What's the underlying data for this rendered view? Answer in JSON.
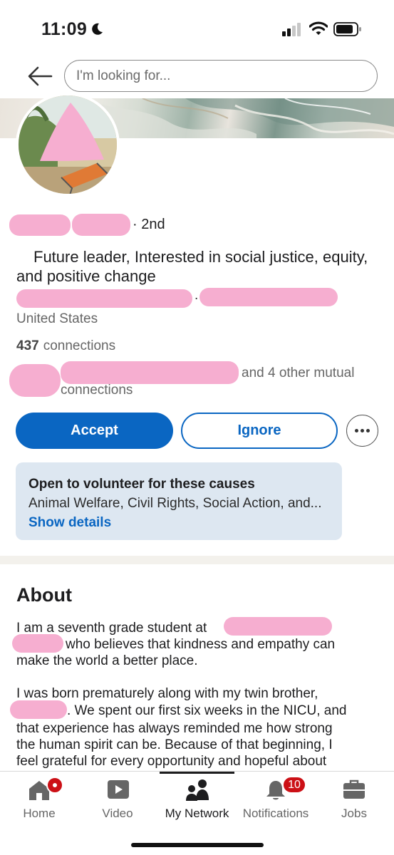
{
  "status_bar": {
    "time": "11:09"
  },
  "search": {
    "placeholder": "I'm looking for..."
  },
  "profile": {
    "degree": "· 2nd",
    "headline": "Future leader, Interested in social justice, equity, and positive change",
    "location_separator": ".",
    "location": "United States",
    "connections_count": "437",
    "connections_label": "connections",
    "mutual_text_a": "and 4 other mutual",
    "mutual_text_b": "connections"
  },
  "actions": {
    "accept": "Accept",
    "ignore": "Ignore",
    "more_icon": "ellipsis-icon"
  },
  "volunteer": {
    "title": "Open to volunteer for these causes",
    "causes": "Animal Welfare, Civil Rights, Social Action, and...",
    "link": "Show details"
  },
  "about": {
    "title": "About",
    "lines": [
      "I am a seventh grade student at",
      "who believes that kindness and empathy can",
      "make the world a better place.",
      "I was born prematurely along with my twin brother,",
      ". We spent our first six weeks in the NICU, and",
      "that experience has always reminded me how strong",
      "the human spirit can be. Because of that beginning, I",
      "feel grateful for every opportunity and hopeful about"
    ]
  },
  "tabs": [
    {
      "label": "Home",
      "icon": "home-icon",
      "badge": ""
    },
    {
      "label": "Video",
      "icon": "video-icon",
      "badge": ""
    },
    {
      "label": "My Network",
      "icon": "network-icon",
      "badge": "",
      "active": true
    },
    {
      "label": "Notifications",
      "icon": "bell-icon",
      "badge": "10"
    },
    {
      "label": "Jobs",
      "icon": "briefcase-icon",
      "badge": ""
    }
  ],
  "colors": {
    "primary": "#0a66c2",
    "badge": "#cc1016",
    "redaction": "#f6aed0",
    "volunteer_bg": "#dde7f1"
  }
}
